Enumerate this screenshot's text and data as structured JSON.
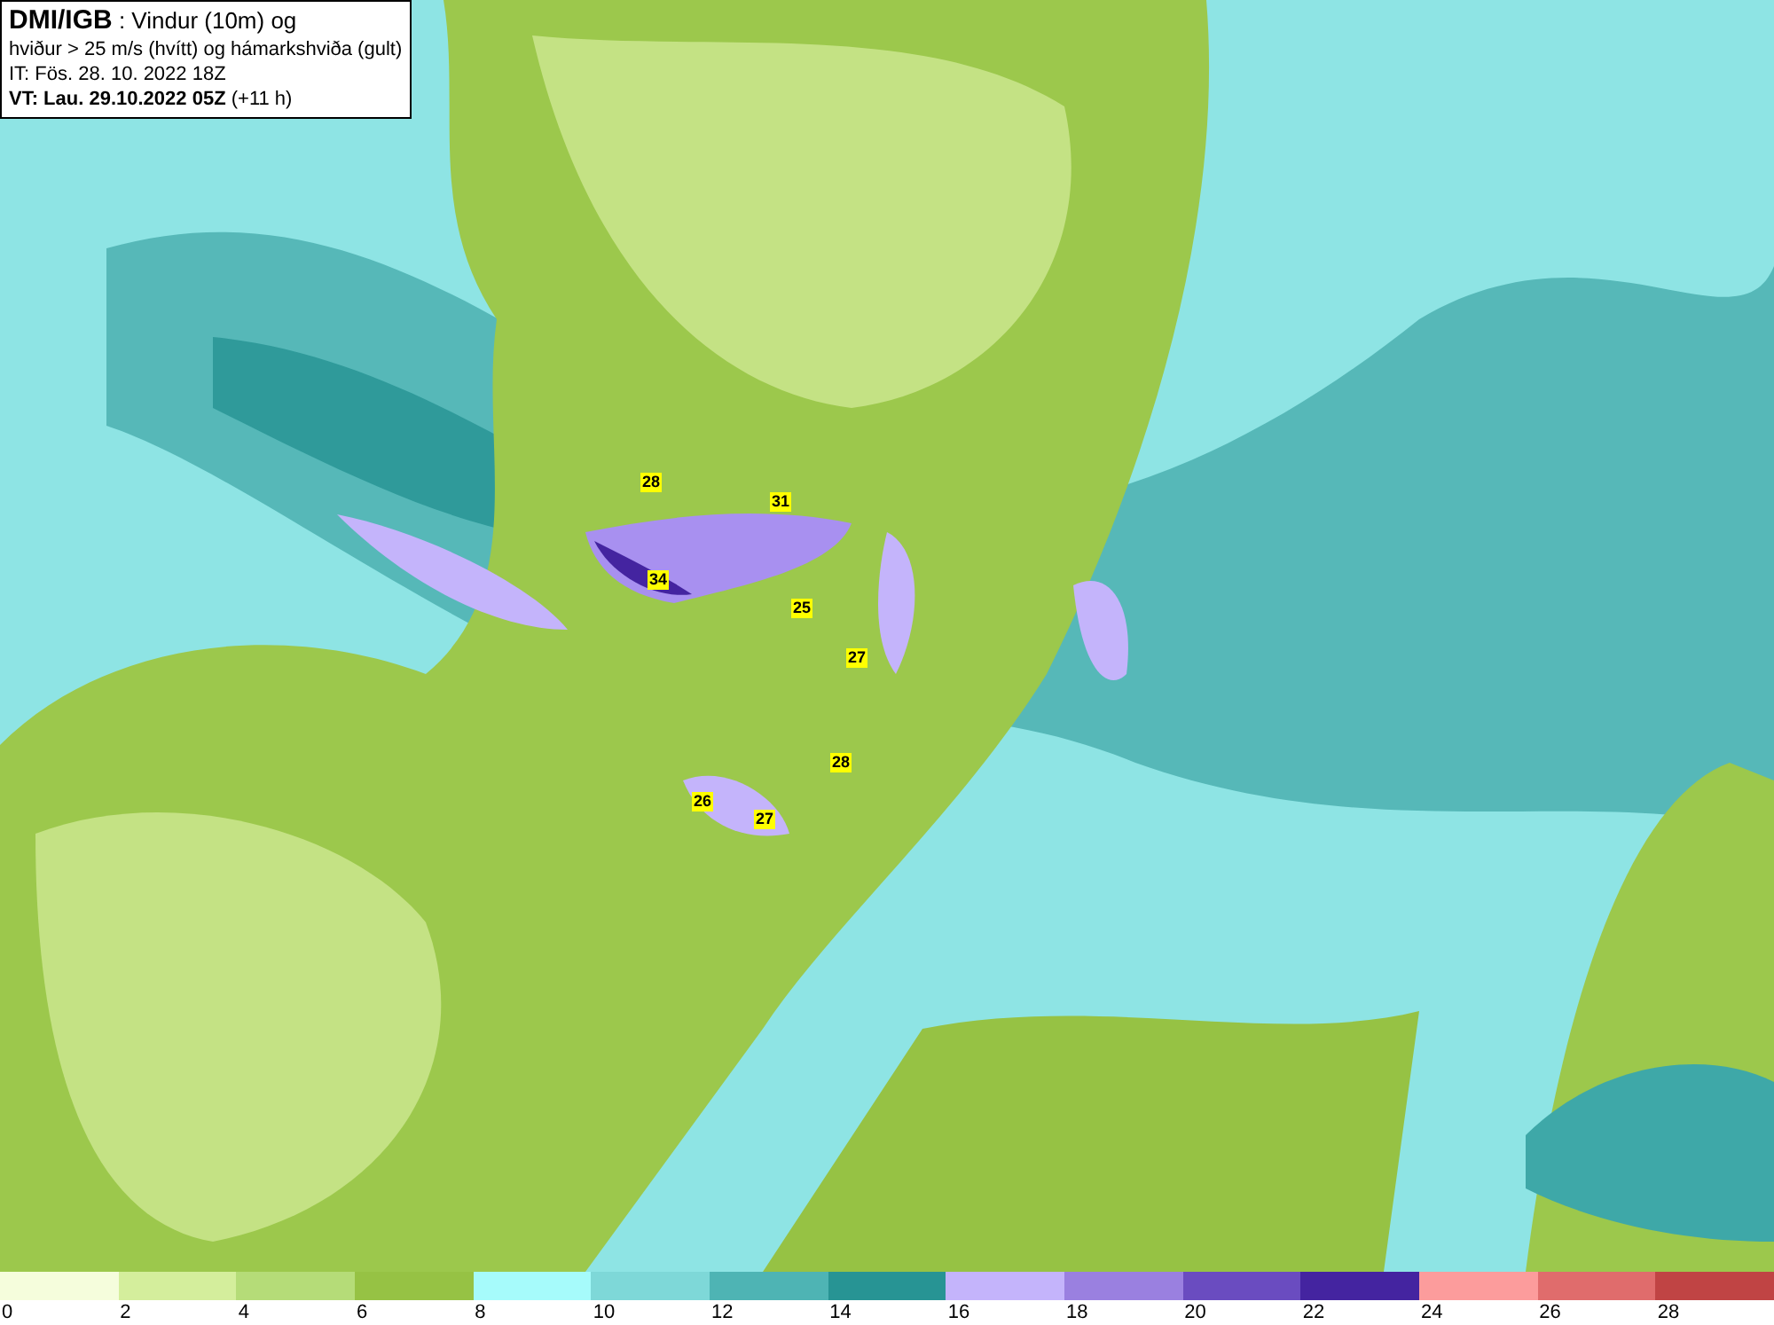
{
  "title_box": {
    "lines": [
      "**DMI/IGB** : Vindur (10m) og",
      "hviður > 25 m/s (hvítt) og hámarkshviða (gult)",
      "IT: Fös. 28. 10. 2022 18Z",
      "**VT: Lau. 29.10.2022 05Z** (+11 h)"
    ]
  },
  "map": {
    "gust_labels": [
      "28",
      "31",
      "34",
      "25",
      "27",
      "28",
      "26",
      "27"
    ]
  },
  "legend": [
    {
      "tick": "0",
      "color": "#f5fddc"
    },
    {
      "tick": "2",
      "color": "#d4ee9c"
    },
    {
      "tick": "4",
      "color": "#b5dc78"
    },
    {
      "tick": "6",
      "color": "#96c244"
    },
    {
      "tick": "8",
      "color": "#a6fbfb"
    },
    {
      "tick": "10",
      "color": "#7ed8d8"
    },
    {
      "tick": "12",
      "color": "#4eb4b4"
    },
    {
      "tick": "14",
      "color": "#279494"
    },
    {
      "tick": "16",
      "color": "#c4b4fb"
    },
    {
      "tick": "18",
      "color": "#9a80e0"
    },
    {
      "tick": "20",
      "color": "#6a4cc0"
    },
    {
      "tick": "22",
      "color": "#4424a0"
    },
    {
      "tick": "24",
      "color": "#fc9c9c"
    },
    {
      "tick": "26",
      "color": "#e06c6c"
    },
    {
      "tick": "28",
      "color": "#c04444"
    }
  ]
}
